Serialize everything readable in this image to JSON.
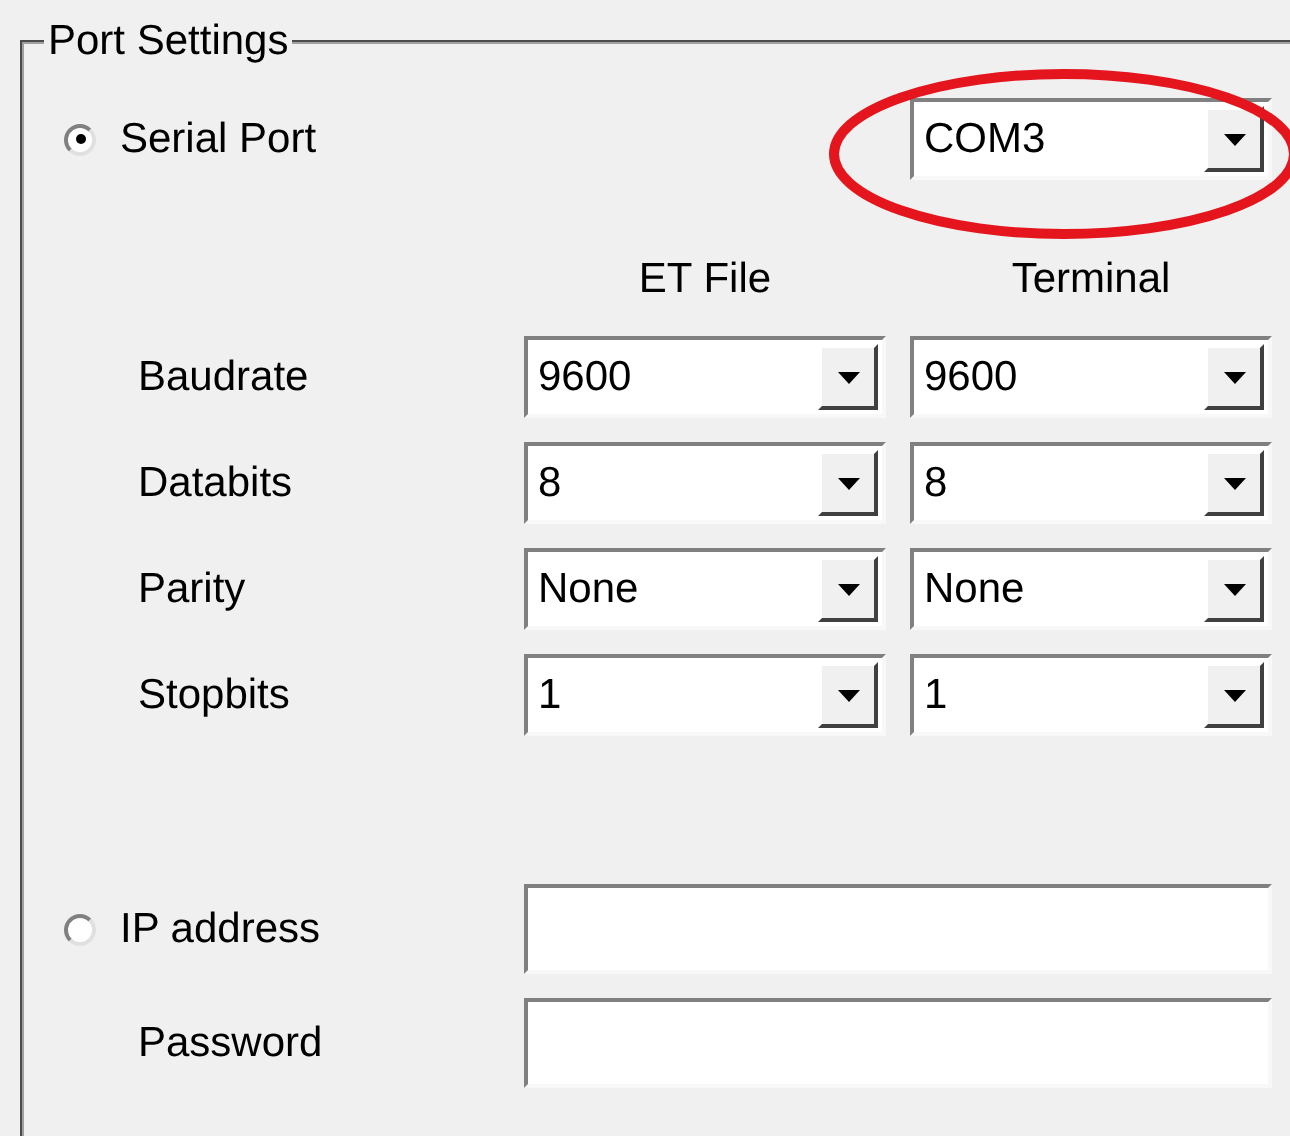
{
  "group": {
    "title": "Port Settings"
  },
  "serial_port": {
    "label": "Serial Port",
    "selected": true,
    "port": "COM3"
  },
  "highlight": {
    "kind": "ellipse"
  },
  "columns": [
    "ET File",
    "Terminal"
  ],
  "settings": [
    {
      "label": "Baudrate",
      "et_file": "9600",
      "terminal": "9600"
    },
    {
      "label": "Databits",
      "et_file": "8",
      "terminal": "8"
    },
    {
      "label": "Parity",
      "et_file": "None",
      "terminal": "None"
    },
    {
      "label": "Stopbits",
      "et_file": "1",
      "terminal": "1"
    }
  ],
  "ip_address": {
    "label": "IP address",
    "selected": false
  },
  "password": {
    "label": "Password"
  }
}
